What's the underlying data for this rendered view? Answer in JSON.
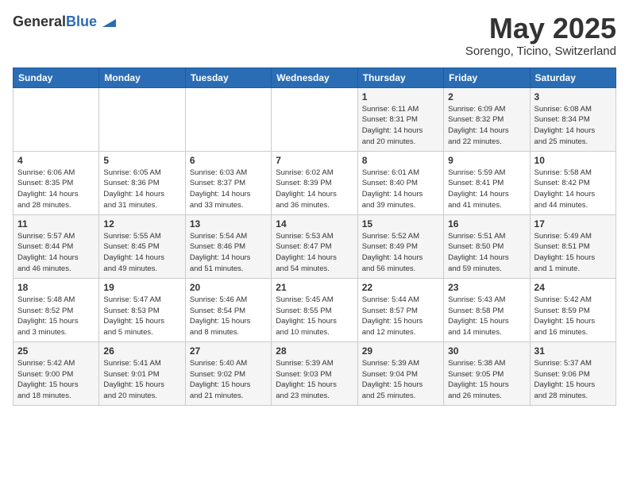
{
  "header": {
    "logo_general": "General",
    "logo_blue": "Blue",
    "month": "May 2025",
    "location": "Sorengo, Ticino, Switzerland"
  },
  "weekdays": [
    "Sunday",
    "Monday",
    "Tuesday",
    "Wednesday",
    "Thursday",
    "Friday",
    "Saturday"
  ],
  "weeks": [
    [
      {
        "day": "",
        "info": ""
      },
      {
        "day": "",
        "info": ""
      },
      {
        "day": "",
        "info": ""
      },
      {
        "day": "",
        "info": ""
      },
      {
        "day": "1",
        "info": "Sunrise: 6:11 AM\nSunset: 8:31 PM\nDaylight: 14 hours\nand 20 minutes."
      },
      {
        "day": "2",
        "info": "Sunrise: 6:09 AM\nSunset: 8:32 PM\nDaylight: 14 hours\nand 22 minutes."
      },
      {
        "day": "3",
        "info": "Sunrise: 6:08 AM\nSunset: 8:34 PM\nDaylight: 14 hours\nand 25 minutes."
      }
    ],
    [
      {
        "day": "4",
        "info": "Sunrise: 6:06 AM\nSunset: 8:35 PM\nDaylight: 14 hours\nand 28 minutes."
      },
      {
        "day": "5",
        "info": "Sunrise: 6:05 AM\nSunset: 8:36 PM\nDaylight: 14 hours\nand 31 minutes."
      },
      {
        "day": "6",
        "info": "Sunrise: 6:03 AM\nSunset: 8:37 PM\nDaylight: 14 hours\nand 33 minutes."
      },
      {
        "day": "7",
        "info": "Sunrise: 6:02 AM\nSunset: 8:39 PM\nDaylight: 14 hours\nand 36 minutes."
      },
      {
        "day": "8",
        "info": "Sunrise: 6:01 AM\nSunset: 8:40 PM\nDaylight: 14 hours\nand 39 minutes."
      },
      {
        "day": "9",
        "info": "Sunrise: 5:59 AM\nSunset: 8:41 PM\nDaylight: 14 hours\nand 41 minutes."
      },
      {
        "day": "10",
        "info": "Sunrise: 5:58 AM\nSunset: 8:42 PM\nDaylight: 14 hours\nand 44 minutes."
      }
    ],
    [
      {
        "day": "11",
        "info": "Sunrise: 5:57 AM\nSunset: 8:44 PM\nDaylight: 14 hours\nand 46 minutes."
      },
      {
        "day": "12",
        "info": "Sunrise: 5:55 AM\nSunset: 8:45 PM\nDaylight: 14 hours\nand 49 minutes."
      },
      {
        "day": "13",
        "info": "Sunrise: 5:54 AM\nSunset: 8:46 PM\nDaylight: 14 hours\nand 51 minutes."
      },
      {
        "day": "14",
        "info": "Sunrise: 5:53 AM\nSunset: 8:47 PM\nDaylight: 14 hours\nand 54 minutes."
      },
      {
        "day": "15",
        "info": "Sunrise: 5:52 AM\nSunset: 8:49 PM\nDaylight: 14 hours\nand 56 minutes."
      },
      {
        "day": "16",
        "info": "Sunrise: 5:51 AM\nSunset: 8:50 PM\nDaylight: 14 hours\nand 59 minutes."
      },
      {
        "day": "17",
        "info": "Sunrise: 5:49 AM\nSunset: 8:51 PM\nDaylight: 15 hours\nand 1 minute."
      }
    ],
    [
      {
        "day": "18",
        "info": "Sunrise: 5:48 AM\nSunset: 8:52 PM\nDaylight: 15 hours\nand 3 minutes."
      },
      {
        "day": "19",
        "info": "Sunrise: 5:47 AM\nSunset: 8:53 PM\nDaylight: 15 hours\nand 5 minutes."
      },
      {
        "day": "20",
        "info": "Sunrise: 5:46 AM\nSunset: 8:54 PM\nDaylight: 15 hours\nand 8 minutes."
      },
      {
        "day": "21",
        "info": "Sunrise: 5:45 AM\nSunset: 8:55 PM\nDaylight: 15 hours\nand 10 minutes."
      },
      {
        "day": "22",
        "info": "Sunrise: 5:44 AM\nSunset: 8:57 PM\nDaylight: 15 hours\nand 12 minutes."
      },
      {
        "day": "23",
        "info": "Sunrise: 5:43 AM\nSunset: 8:58 PM\nDaylight: 15 hours\nand 14 minutes."
      },
      {
        "day": "24",
        "info": "Sunrise: 5:42 AM\nSunset: 8:59 PM\nDaylight: 15 hours\nand 16 minutes."
      }
    ],
    [
      {
        "day": "25",
        "info": "Sunrise: 5:42 AM\nSunset: 9:00 PM\nDaylight: 15 hours\nand 18 minutes."
      },
      {
        "day": "26",
        "info": "Sunrise: 5:41 AM\nSunset: 9:01 PM\nDaylight: 15 hours\nand 20 minutes."
      },
      {
        "day": "27",
        "info": "Sunrise: 5:40 AM\nSunset: 9:02 PM\nDaylight: 15 hours\nand 21 minutes."
      },
      {
        "day": "28",
        "info": "Sunrise: 5:39 AM\nSunset: 9:03 PM\nDaylight: 15 hours\nand 23 minutes."
      },
      {
        "day": "29",
        "info": "Sunrise: 5:39 AM\nSunset: 9:04 PM\nDaylight: 15 hours\nand 25 minutes."
      },
      {
        "day": "30",
        "info": "Sunrise: 5:38 AM\nSunset: 9:05 PM\nDaylight: 15 hours\nand 26 minutes."
      },
      {
        "day": "31",
        "info": "Sunrise: 5:37 AM\nSunset: 9:06 PM\nDaylight: 15 hours\nand 28 minutes."
      }
    ]
  ]
}
